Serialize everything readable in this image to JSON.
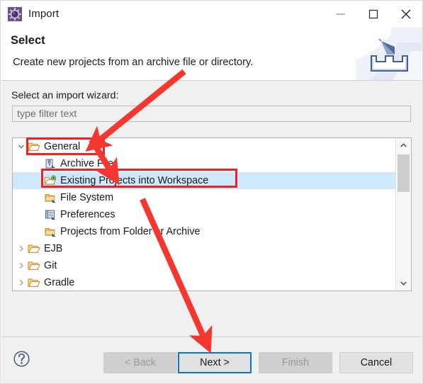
{
  "window": {
    "title": "Import",
    "icon": "import-wizard-icon",
    "controls": {
      "minimize": "minimize-icon",
      "maximize": "maximize-icon",
      "close": "close-icon"
    }
  },
  "header": {
    "title": "Select",
    "description": "Create new projects from an archive file or directory.",
    "banner_icon": "import-tray-arrow-icon"
  },
  "body": {
    "tree_label": "Select an import wizard:",
    "filter": {
      "value": "",
      "placeholder": "type filter text"
    },
    "tree": [
      {
        "label": "General",
        "icon": "folder-open-icon",
        "indent": 0,
        "twisty": "expanded",
        "selected": false
      },
      {
        "label": "Archive File",
        "icon": "archive-file-icon",
        "indent": 1,
        "twisty": "none",
        "selected": false
      },
      {
        "label": "Existing Projects into Workspace",
        "icon": "import-projects-icon",
        "indent": 1,
        "twisty": "none",
        "selected": true
      },
      {
        "label": "File System",
        "icon": "folder-import-icon",
        "indent": 1,
        "twisty": "none",
        "selected": false
      },
      {
        "label": "Preferences",
        "icon": "preferences-icon",
        "indent": 1,
        "twisty": "none",
        "selected": false
      },
      {
        "label": "Projects from Folder or Archive",
        "icon": "folder-import-icon",
        "indent": 1,
        "twisty": "none",
        "selected": false
      },
      {
        "label": "EJB",
        "icon": "folder-open-icon",
        "indent": 0,
        "twisty": "collapsed",
        "selected": false
      },
      {
        "label": "Git",
        "icon": "folder-open-icon",
        "indent": 0,
        "twisty": "collapsed",
        "selected": false
      },
      {
        "label": "Gradle",
        "icon": "folder-open-icon",
        "indent": 0,
        "twisty": "collapsed",
        "selected": false
      }
    ],
    "scrollbar": {
      "up_arrow": "chevron-up-icon",
      "down_arrow": "chevron-down-icon"
    }
  },
  "footer": {
    "help_icon": "help-question-icon",
    "buttons": [
      {
        "label": "< Back",
        "state": "disabled"
      },
      {
        "label": "Next >",
        "state": "default-focused"
      },
      {
        "label": "Finish",
        "state": "disabled"
      },
      {
        "label": "Cancel",
        "state": "enabled"
      }
    ]
  },
  "annotations": {
    "color": "#ee2222",
    "boxes": [
      {
        "target": "General"
      },
      {
        "target": "Existing Projects into Workspace"
      }
    ],
    "arrows": [
      {
        "from_to": "points to General row"
      },
      {
        "from_to": "points to Existing Projects into Workspace row"
      },
      {
        "from_to": "points to Next > button"
      }
    ]
  },
  "colors": {
    "accent_blue": "#0078d7",
    "selection_blue": "#cde8ff",
    "annotation_red": "#ee2222",
    "dialog_gray": "#f0f0f0"
  }
}
